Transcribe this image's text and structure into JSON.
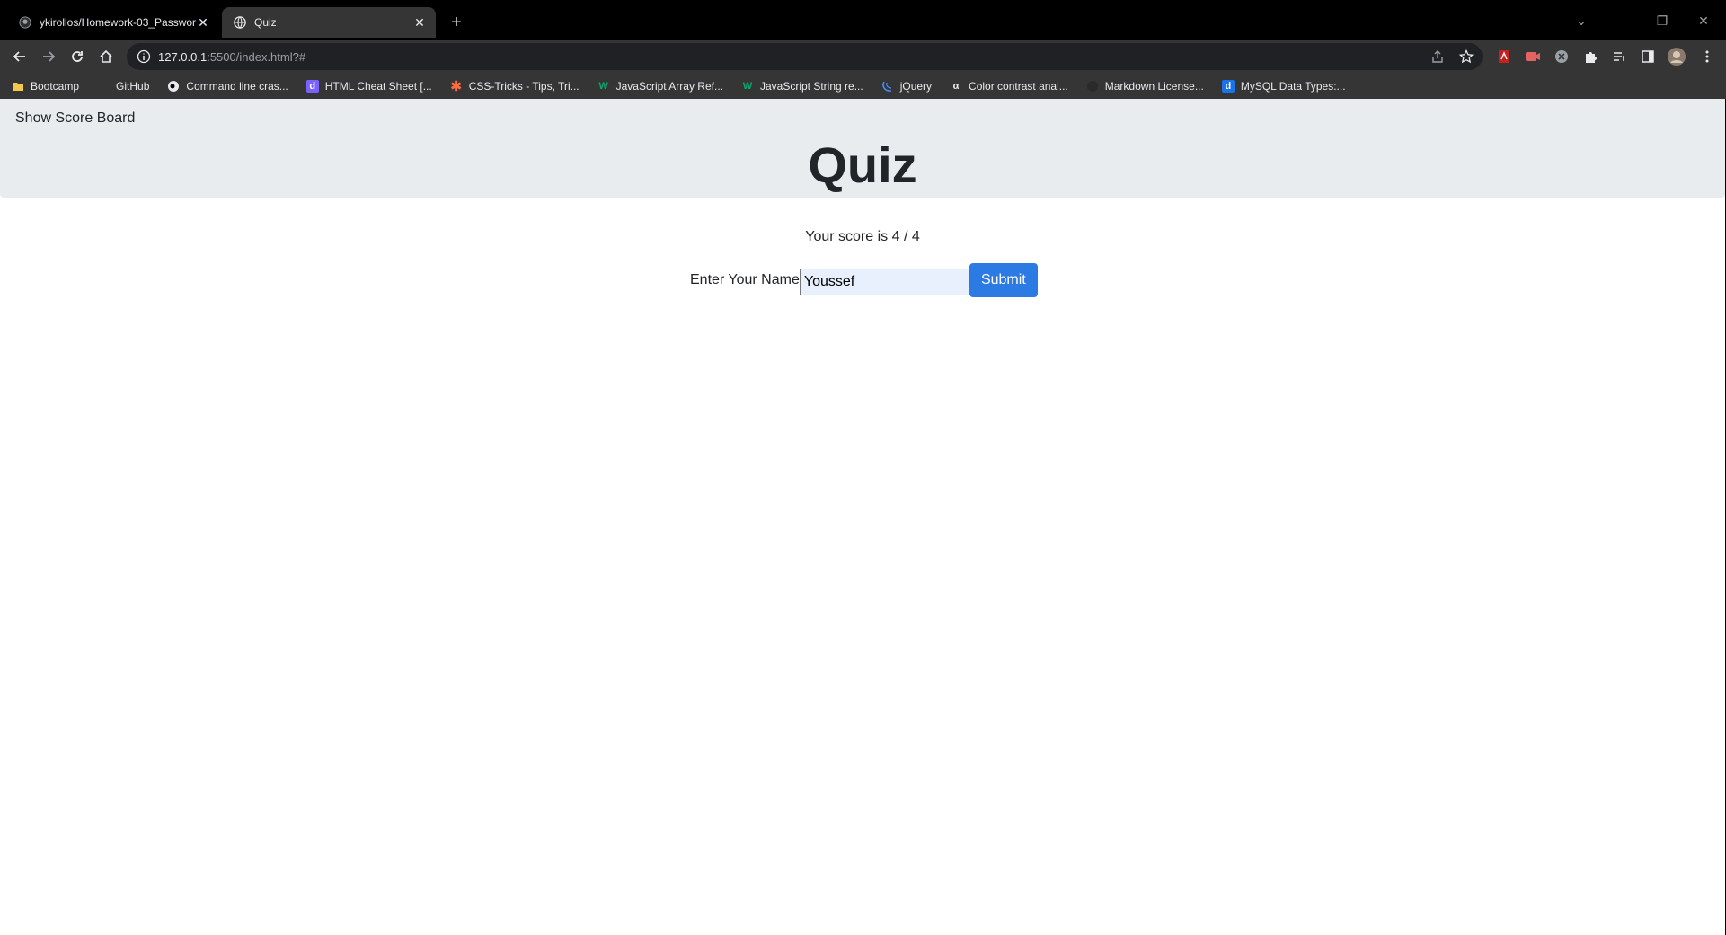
{
  "browser": {
    "tabs": [
      {
        "title": "ykirollos/Homework-03_Passwor",
        "active": false,
        "icon": "github-icon"
      },
      {
        "title": "Quiz",
        "active": true,
        "icon": "globe-icon"
      }
    ],
    "new_tab": "+",
    "url": {
      "host": "127.0.0.1",
      "rest": ":5500/index.html?#"
    },
    "bookmarks": [
      {
        "label": "Bootcamp",
        "icon": "folder-icon",
        "color": "#f2c94c"
      },
      {
        "label": "GitHub",
        "icon": "github-icon",
        "color": "#e8eaed"
      },
      {
        "label": "Command line cras...",
        "icon": "terminal-icon",
        "color": "#e8eaed"
      },
      {
        "label": "HTML Cheat Sheet [...",
        "icon": "d-icon",
        "color": "#7b61ff"
      },
      {
        "label": "CSS-Tricks - Tips, Tri...",
        "icon": "asterisk-icon",
        "color": "#ff6b3d"
      },
      {
        "label": "JavaScript Array Ref...",
        "icon": "w3-icon",
        "color": "#04aa6d"
      },
      {
        "label": "JavaScript String re...",
        "icon": "w3-icon",
        "color": "#04aa6d"
      },
      {
        "label": "jQuery",
        "icon": "jquery-icon",
        "color": "#4b8bf5"
      },
      {
        "label": "Color contrast anal...",
        "icon": "contrast-icon",
        "color": "#e8eaed"
      },
      {
        "label": "Markdown License...",
        "icon": "markdown-icon",
        "color": "#353535"
      },
      {
        "label": "MySQL Data Types:...",
        "icon": "d-icon",
        "color": "#1a73e8"
      }
    ]
  },
  "page": {
    "show_score_board": "Show Score Board",
    "title": "Quiz",
    "score_text": "Your score is 4 / 4",
    "name_label": "Enter Your Name",
    "name_value": "Youssef",
    "submit_label": "Submit"
  }
}
